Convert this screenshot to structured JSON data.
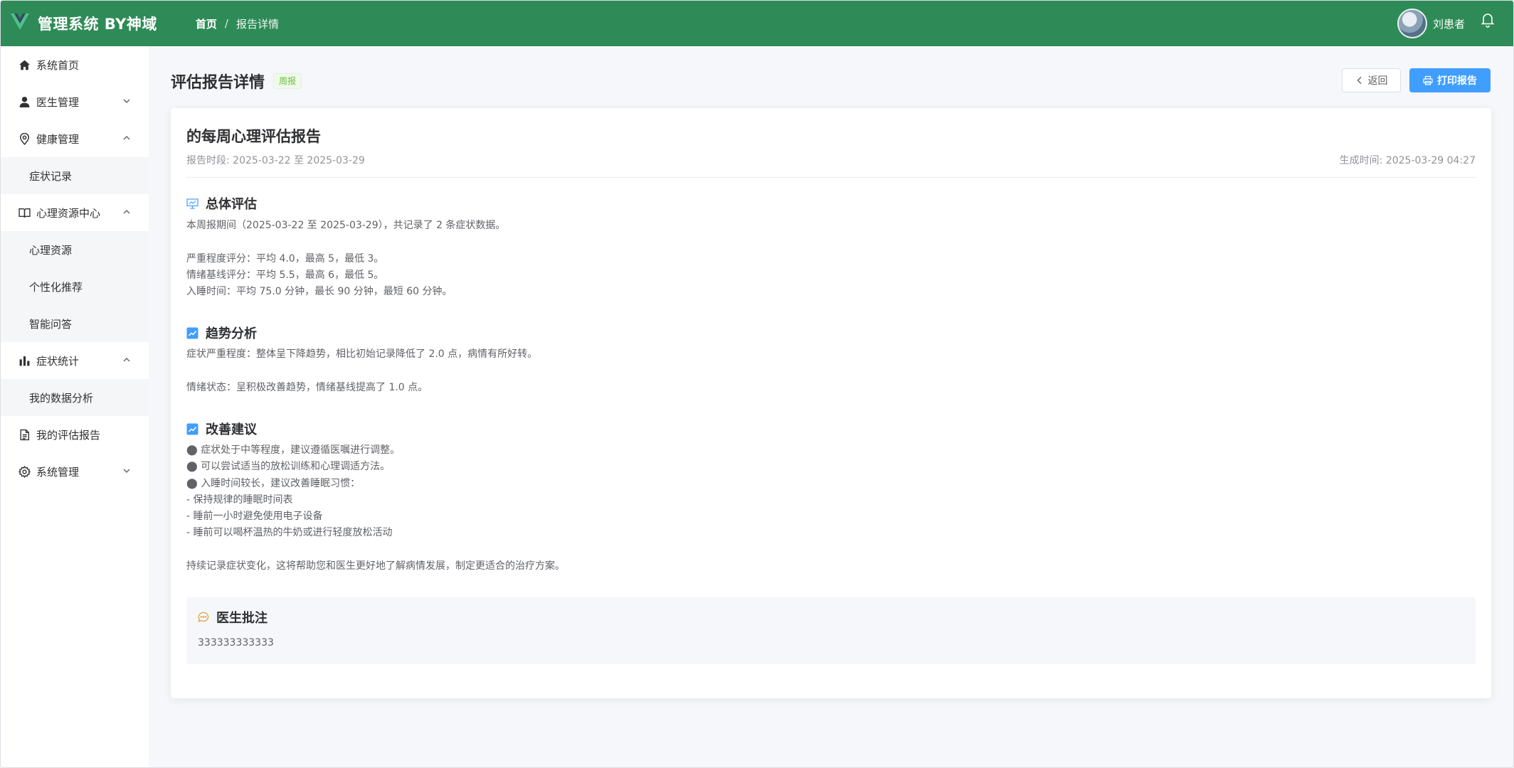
{
  "header": {
    "app_title": "管理系统 BY神域",
    "breadcrumb": {
      "home": "首页",
      "separator": "/",
      "current": "报告详情"
    },
    "username": "刘患者",
    "brand_color": "#2e8b57"
  },
  "sidebar": {
    "items": [
      {
        "label": "系统首页",
        "icon": "home-icon"
      },
      {
        "label": "医生管理",
        "icon": "user-icon",
        "expanded": false
      },
      {
        "label": "健康管理",
        "icon": "location-icon",
        "expanded": true,
        "children": [
          "症状记录"
        ]
      },
      {
        "label": "心理资源中心",
        "icon": "book-icon",
        "expanded": true,
        "children": [
          "心理资源",
          "个性化推荐",
          "智能问答"
        ]
      },
      {
        "label": "症状统计",
        "icon": "bar-chart-icon",
        "expanded": true,
        "children": [
          "我的数据分析"
        ]
      },
      {
        "label": "我的评估报告",
        "icon": "document-icon"
      },
      {
        "label": "系统管理",
        "icon": "settings-icon",
        "expanded": false
      }
    ]
  },
  "page": {
    "title": "评估报告详情",
    "tag": "周报",
    "back_label": "返回",
    "print_label": "打印报告"
  },
  "report": {
    "title": "的每周心理评估报告",
    "period": "报告时段: 2025-03-22 至 2025-03-29",
    "generated": "生成时间: 2025-03-29 04:27",
    "sections": {
      "overall": {
        "title": "总体评估",
        "body": "本周报期间（2025-03-22 至 2025-03-29），共记录了 2 条症状数据。\n\n严重程度评分：平均 4.0，最高 5，最低 3。\n情绪基线评分：平均 5.5，最高 6，最低 5。\n入睡时间：平均 75.0 分钟，最长 90 分钟，最短 60 分钟。"
      },
      "trend": {
        "title": "趋势分析",
        "body": "症状严重程度：整体呈下降趋势，相比初始记录降低了 2.0 点，病情有所好转。\n\n情绪状态：呈积极改善趋势，情绪基线提高了 1.0 点。"
      },
      "advice": {
        "title": "改善建议",
        "body": "⬤ 症状处于中等程度，建议遵循医嘱进行调整。\n⬤ 可以尝试适当的放松训练和心理调适方法。\n⬤ 入睡时间较长，建议改善睡眠习惯：\n- 保持规律的睡眠时间表\n- 睡前一小时避免使用电子设备\n- 睡前可以喝杯温热的牛奶或进行轻度放松活动\n\n持续记录症状变化，这将帮助您和医生更好地了解病情发展，制定更适合的治疗方案。"
      }
    },
    "doctor_note": {
      "title": "医生批注",
      "content": "333333333333"
    }
  }
}
